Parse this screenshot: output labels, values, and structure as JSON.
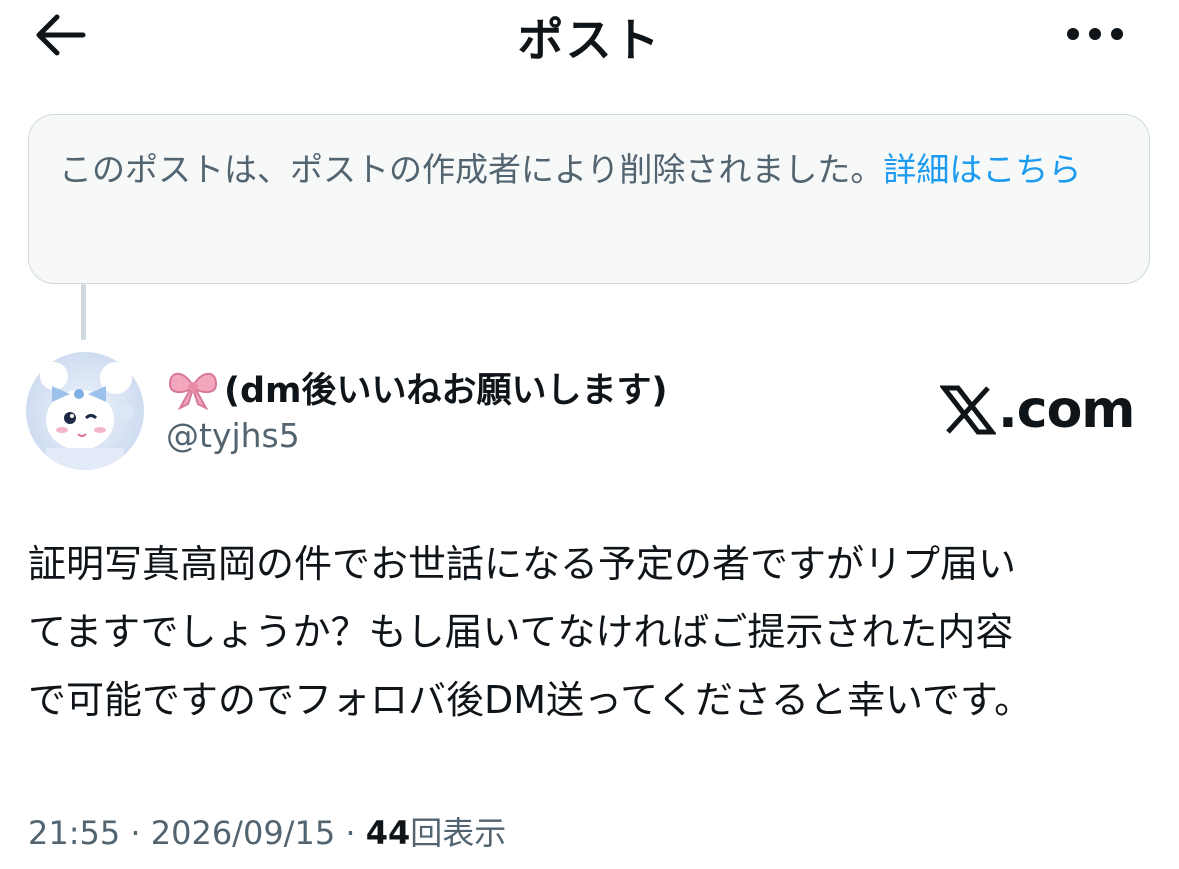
{
  "header": {
    "title": "ポスト",
    "back_icon": "arrow-left-icon",
    "more_icon": "more-horizontal-icon"
  },
  "notice": {
    "text": "このポストは、ポストの作成者により削除されました。",
    "link_label": "詳細はこちら"
  },
  "author": {
    "display_name": "(dm後いいねお願いします)",
    "handle": "@tyjhs5",
    "name_icon": "ribbon-bow-icon"
  },
  "watermark": {
    "text": ".com",
    "icon": "x-logo-icon"
  },
  "post": {
    "lines": [
      "証明写真高岡の件でお世話になる予定の者ですがリプ届い",
      "てますでしょうか？もし届いてなければご提示された内容",
      "で可能ですのでフォロバ後DM送ってくださると幸いです。"
    ]
  },
  "meta": {
    "time": "21:55",
    "separator": "·",
    "date": "2026/09/15",
    "views_count": "44",
    "views_label": "回表示"
  },
  "colors": {
    "accent": "#1d9bf0",
    "secondary_text": "#536471",
    "primary_text": "#0f1419",
    "notice_bg": "#f7f9f9",
    "border": "#cfd9de"
  }
}
